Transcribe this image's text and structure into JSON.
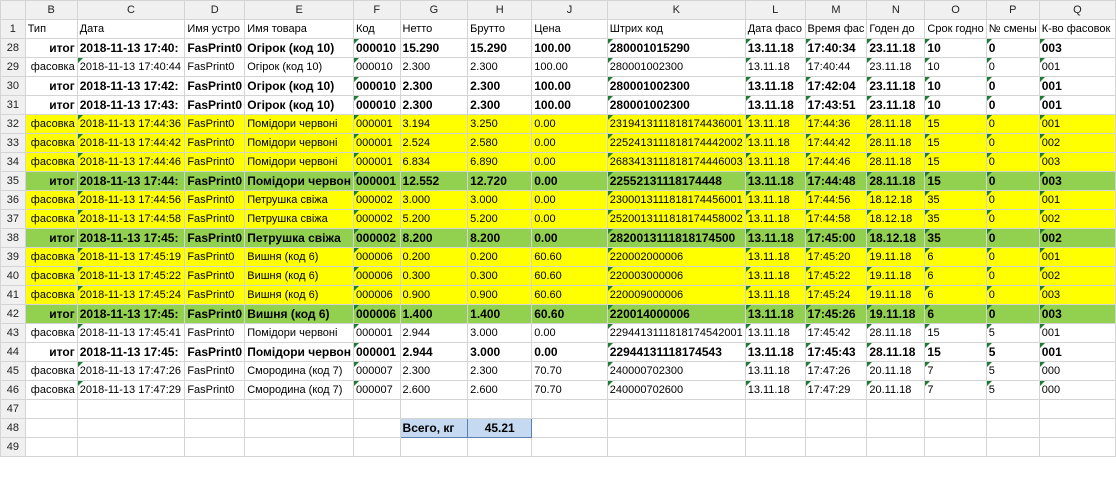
{
  "columns": [
    "B",
    "C",
    "D",
    "E",
    "F",
    "G",
    "H",
    "J",
    "K",
    "L",
    "M",
    "N",
    "O",
    "P",
    "Q"
  ],
  "header_row": {
    "num": "1",
    "cells": [
      "Тип",
      "Дата",
      "Имя устро",
      "Имя товара",
      "Код",
      "Нетто",
      "Брутто",
      "Цена",
      "Штрих код",
      "Дата фасо",
      "Время фас",
      "Годен до",
      "Срок годно",
      "№ смены",
      "К-во фасовок"
    ]
  },
  "rows": [
    {
      "num": "28",
      "style": "bold",
      "cells": [
        "итог",
        "2018-11-13 17:40:",
        "FasPrint0",
        "Огірок (код 10)",
        "000010",
        "15.290",
        "15.290",
        "100.00",
        "280001015290",
        "13.11.18",
        "17:40:34",
        "23.11.18",
        "10",
        "0",
        "003"
      ]
    },
    {
      "num": "29",
      "style": "plain",
      "cells": [
        "фасовка",
        "2018-11-13 17:40:44",
        "FasPrint0",
        "Огірок (код 10)",
        "000010",
        "2.300",
        "2.300",
        "100.00",
        "280001002300",
        "13.11.18",
        "17:40:44",
        "23.11.18",
        "10",
        "0",
        "001"
      ]
    },
    {
      "num": "30",
      "style": "bold",
      "cells": [
        "итог",
        "2018-11-13 17:42:",
        "FasPrint0",
        "Огірок (код 10)",
        "000010",
        "2.300",
        "2.300",
        "100.00",
        "280001002300",
        "13.11.18",
        "17:42:04",
        "23.11.18",
        "10",
        "0",
        "001"
      ]
    },
    {
      "num": "31",
      "style": "bold",
      "cells": [
        "итог",
        "2018-11-13 17:43:",
        "FasPrint0",
        "Огірок (код 10)",
        "000010",
        "2.300",
        "2.300",
        "100.00",
        "280001002300",
        "13.11.18",
        "17:43:51",
        "23.11.18",
        "10",
        "0",
        "001"
      ]
    },
    {
      "num": "32",
      "style": "yellow",
      "cells": [
        "фасовка",
        "2018-11-13 17:44:36",
        "FasPrint0",
        "Помідори червоні",
        "000001",
        "3.194",
        "3.250",
        "0.00",
        "2319413111818174436001",
        "13.11.18",
        "17:44:36",
        "28.11.18",
        "15",
        "0",
        "001"
      ]
    },
    {
      "num": "33",
      "style": "yellow",
      "cells": [
        "фасовка",
        "2018-11-13 17:44:42",
        "FasPrint0",
        "Помідори червоні",
        "000001",
        "2.524",
        "2.580",
        "0.00",
        "2252413111818174442002",
        "13.11.18",
        "17:44:42",
        "28.11.18",
        "15",
        "0",
        "002"
      ]
    },
    {
      "num": "34",
      "style": "yellow",
      "cells": [
        "фасовка",
        "2018-11-13 17:44:46",
        "FasPrint0",
        "Помідори червоні",
        "000001",
        "6.834",
        "6.890",
        "0.00",
        "2683413111818174446003",
        "13.11.18",
        "17:44:46",
        "28.11.18",
        "15",
        "0",
        "003"
      ]
    },
    {
      "num": "35",
      "style": "green",
      "cells": [
        "итог",
        "2018-11-13 17:44:",
        "FasPrint0",
        "Помідори червон",
        "000001",
        "12.552",
        "12.720",
        "0.00",
        "22552131118174448",
        "13.11.18",
        "17:44:48",
        "28.11.18",
        "15",
        "0",
        "003"
      ]
    },
    {
      "num": "36",
      "style": "yellow",
      "cells": [
        "фасовка",
        "2018-11-13 17:44:56",
        "FasPrint0",
        "Петрушка свіжа",
        "000002",
        "3.000",
        "3.000",
        "0.00",
        "2300013111818174456001",
        "13.11.18",
        "17:44:56",
        "18.12.18",
        "35",
        "0",
        "001"
      ]
    },
    {
      "num": "37",
      "style": "yellow",
      "cells": [
        "фасовка",
        "2018-11-13 17:44:58",
        "FasPrint0",
        "Петрушка свіжа",
        "000002",
        "5.200",
        "5.200",
        "0.00",
        "2520013111818174458002",
        "13.11.18",
        "17:44:58",
        "18.12.18",
        "35",
        "0",
        "002"
      ]
    },
    {
      "num": "38",
      "style": "green",
      "cells": [
        "итог",
        "2018-11-13 17:45:",
        "FasPrint0",
        "Петрушка свіжа",
        "000002",
        "8.200",
        "8.200",
        "0.00",
        "2820013111818174500",
        "13.11.18",
        "17:45:00",
        "18.12.18",
        "35",
        "0",
        "002"
      ]
    },
    {
      "num": "39",
      "style": "yellow",
      "cells": [
        "фасовка",
        "2018-11-13 17:45:19",
        "FasPrint0",
        "Вишня (код 6)",
        "000006",
        "0.200",
        "0.200",
        "60.60",
        "220002000006",
        "13.11.18",
        "17:45:20",
        "19.11.18",
        "6",
        "0",
        "001"
      ]
    },
    {
      "num": "40",
      "style": "yellow",
      "cells": [
        "фасовка",
        "2018-11-13 17:45:22",
        "FasPrint0",
        "Вишня (код 6)",
        "000006",
        "0.300",
        "0.300",
        "60.60",
        "220003000006",
        "13.11.18",
        "17:45:22",
        "19.11.18",
        "6",
        "0",
        "002"
      ]
    },
    {
      "num": "41",
      "style": "yellow",
      "cells": [
        "фасовка",
        "2018-11-13 17:45:24",
        "FasPrint0",
        "Вишня (код 6)",
        "000006",
        "0.900",
        "0.900",
        "60.60",
        "220009000006",
        "13.11.18",
        "17:45:24",
        "19.11.18",
        "6",
        "0",
        "003"
      ]
    },
    {
      "num": "42",
      "style": "green",
      "cells": [
        "итог",
        "2018-11-13 17:45:",
        "FasPrint0",
        "Вишня (код 6)",
        "000006",
        "1.400",
        "1.400",
        "60.60",
        "220014000006",
        "13.11.18",
        "17:45:26",
        "19.11.18",
        "6",
        "0",
        "003"
      ]
    },
    {
      "num": "43",
      "style": "plain",
      "cells": [
        "фасовка",
        "2018-11-13 17:45:41",
        "FasPrint0",
        "Помідори червоні",
        "000001",
        "2.944",
        "3.000",
        "0.00",
        "2294413111818174542001",
        "13.11.18",
        "17:45:42",
        "28.11.18",
        "15",
        "5",
        "001"
      ]
    },
    {
      "num": "44",
      "style": "bold",
      "cells": [
        "итог",
        "2018-11-13 17:45:",
        "FasPrint0",
        "Помідори червон",
        "000001",
        "2.944",
        "3.000",
        "0.00",
        "22944131118174543",
        "13.11.18",
        "17:45:43",
        "28.11.18",
        "15",
        "5",
        "001"
      ]
    },
    {
      "num": "45",
      "style": "plain",
      "cells": [
        "фасовка",
        "2018-11-13 17:47:26",
        "FasPrint0",
        "Смородина (код 7)",
        "000007",
        "2.300",
        "2.300",
        "70.70",
        "240000702300",
        "13.11.18",
        "17:47:26",
        "20.11.18",
        "7",
        "5",
        "000"
      ]
    },
    {
      "num": "46",
      "style": "plain",
      "cells": [
        "фасовка",
        "2018-11-13 17:47:29",
        "FasPrint0",
        "Смородина (код 7)",
        "000007",
        "2.600",
        "2.600",
        "70.70",
        "240000702600",
        "13.11.18",
        "17:47:29",
        "20.11.18",
        "7",
        "5",
        "000"
      ]
    }
  ],
  "empty_rows": [
    "47",
    "49"
  ],
  "total_row": {
    "num": "48",
    "label": "Всего, кг",
    "value": "45.21"
  }
}
